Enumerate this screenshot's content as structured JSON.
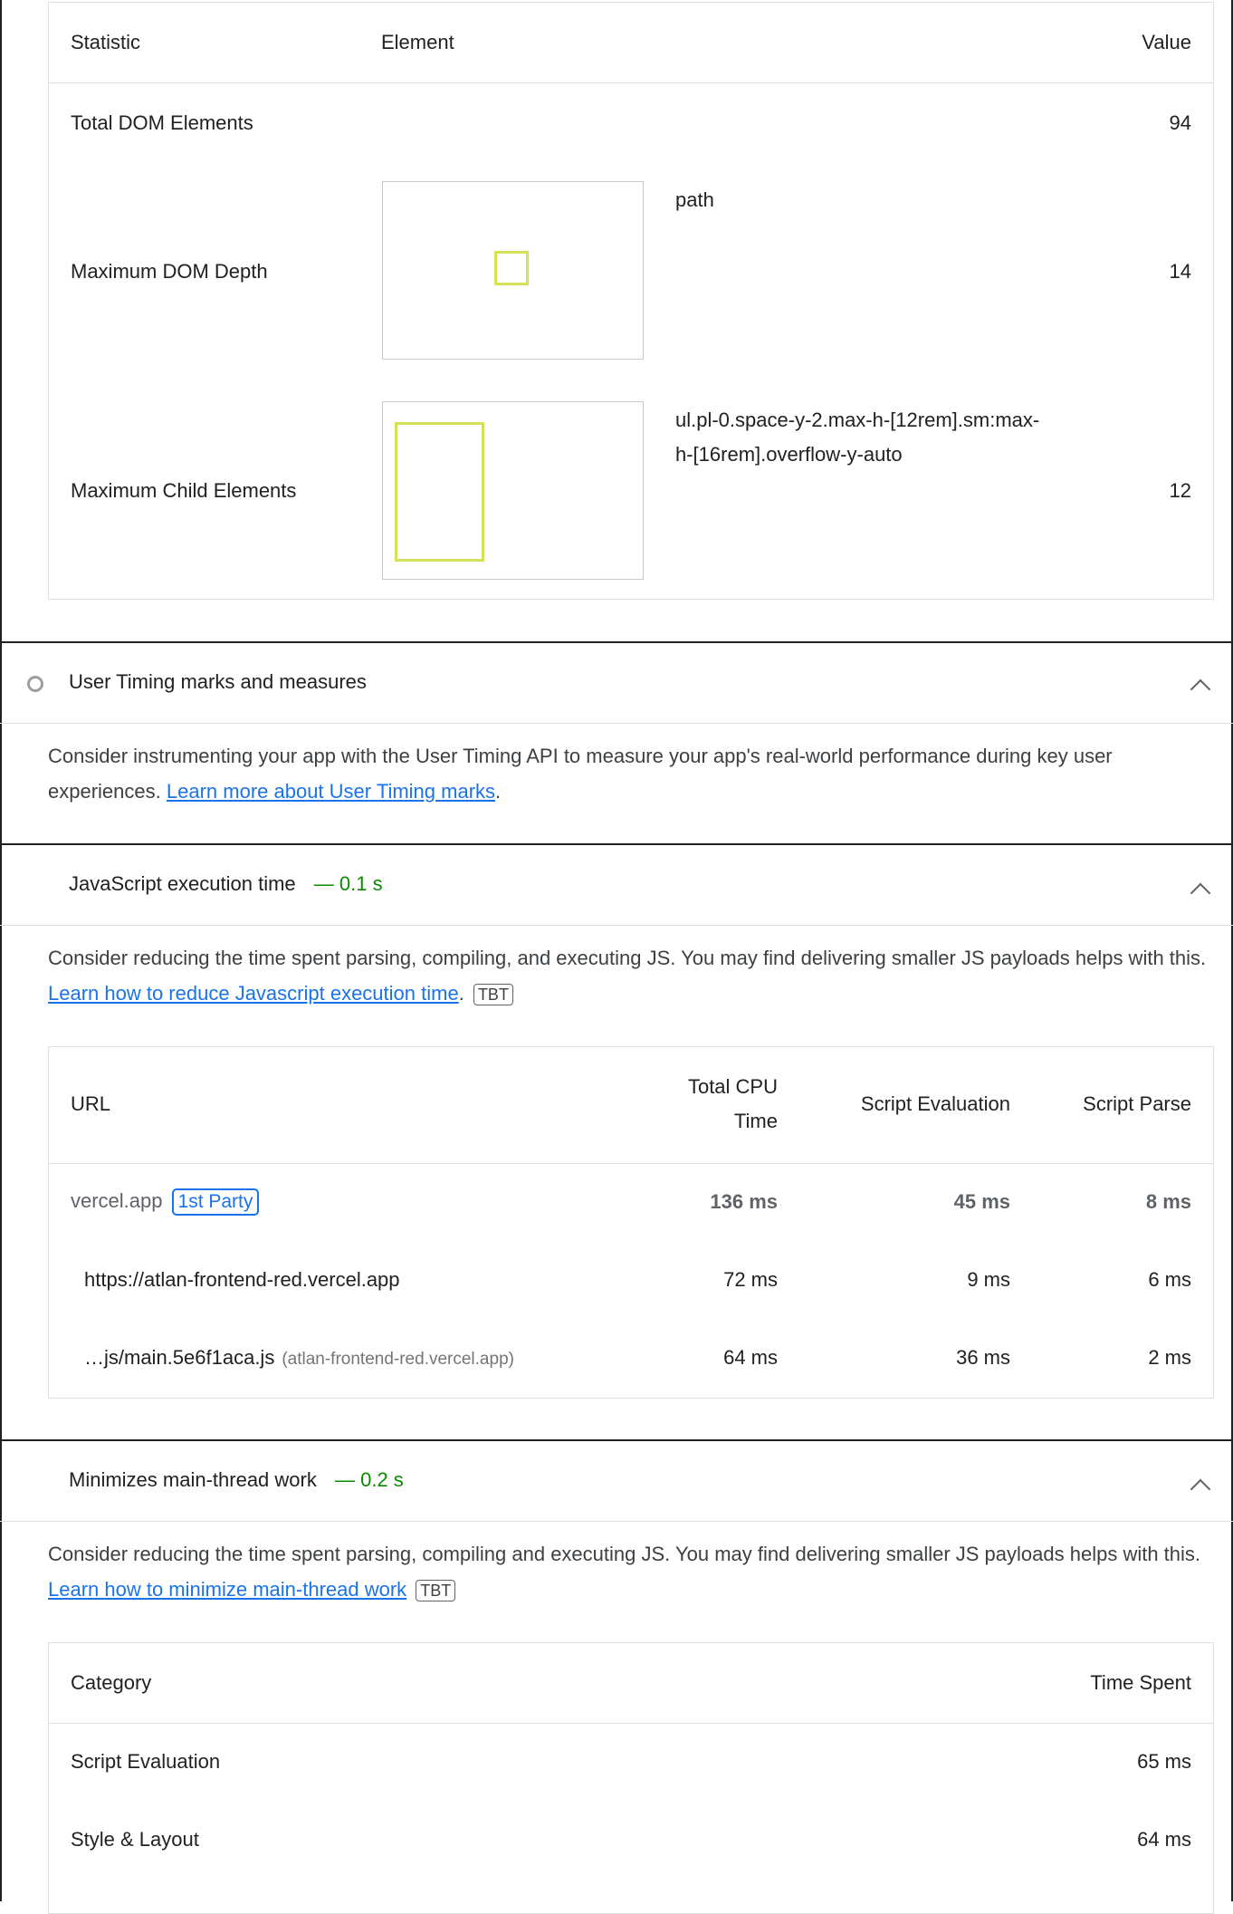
{
  "dom_table": {
    "headers": {
      "statistic": "Statistic",
      "element": "Element",
      "value": "Value"
    },
    "rows": [
      {
        "statistic": "Total DOM Elements",
        "element": "",
        "value": "94"
      },
      {
        "statistic": "Maximum DOM Depth",
        "element": "path",
        "value": "14"
      },
      {
        "statistic": "Maximum Child Elements",
        "element_line1": "ul.pl-0.space-y-2.max-h-[12rem].sm:max-",
        "element_line2": "h-[16rem].overflow-y-auto",
        "value": "12"
      }
    ]
  },
  "user_timing": {
    "title": "User Timing marks and measures",
    "desc": "Consider instrumenting your app with the User Timing API to measure your app's real-world performance during key user experiences.",
    "link": "Learn more about User Timing marks",
    "period": "."
  },
  "js_exec": {
    "title": "JavaScript execution time",
    "value": "— 0.1 s",
    "desc": "Consider reducing the time spent parsing, compiling, and executing JS. You may find delivering smaller JS payloads helps with this.",
    "link": "Learn how to reduce Javascript execution time",
    "period": ".",
    "badge": "TBT",
    "headers": {
      "url": "URL",
      "cpu_line1": "Total CPU",
      "cpu_line2": "Time",
      "eval": "Script Evaluation",
      "parse": "Script Parse"
    },
    "group": {
      "origin": "vercel.app",
      "party": "1st Party",
      "cpu": "136 ms",
      "eval": "45 ms",
      "parse": "8 ms"
    },
    "rows": [
      {
        "url": "https://atlan-frontend-red.vercel.app",
        "host": "",
        "cpu": "72 ms",
        "eval": "9 ms",
        "parse": "6 ms"
      },
      {
        "url": "…js/main.5e6f1aca.js",
        "host": "(atlan-frontend-red.vercel.app)",
        "cpu": "64 ms",
        "eval": "36 ms",
        "parse": "2 ms"
      }
    ]
  },
  "main_thread": {
    "title": "Minimizes main-thread work",
    "value": "— 0.2 s",
    "desc": "Consider reducing the time spent parsing, compiling and executing JS. You may find delivering smaller JS payloads helps with this.",
    "link": "Learn how to minimize main-thread work",
    "badge": "TBT",
    "headers": {
      "category": "Category",
      "time": "Time Spent"
    },
    "rows": [
      {
        "category": "Script Evaluation",
        "time": "65 ms"
      },
      {
        "category": "Style & Layout",
        "time": "64 ms"
      }
    ]
  }
}
